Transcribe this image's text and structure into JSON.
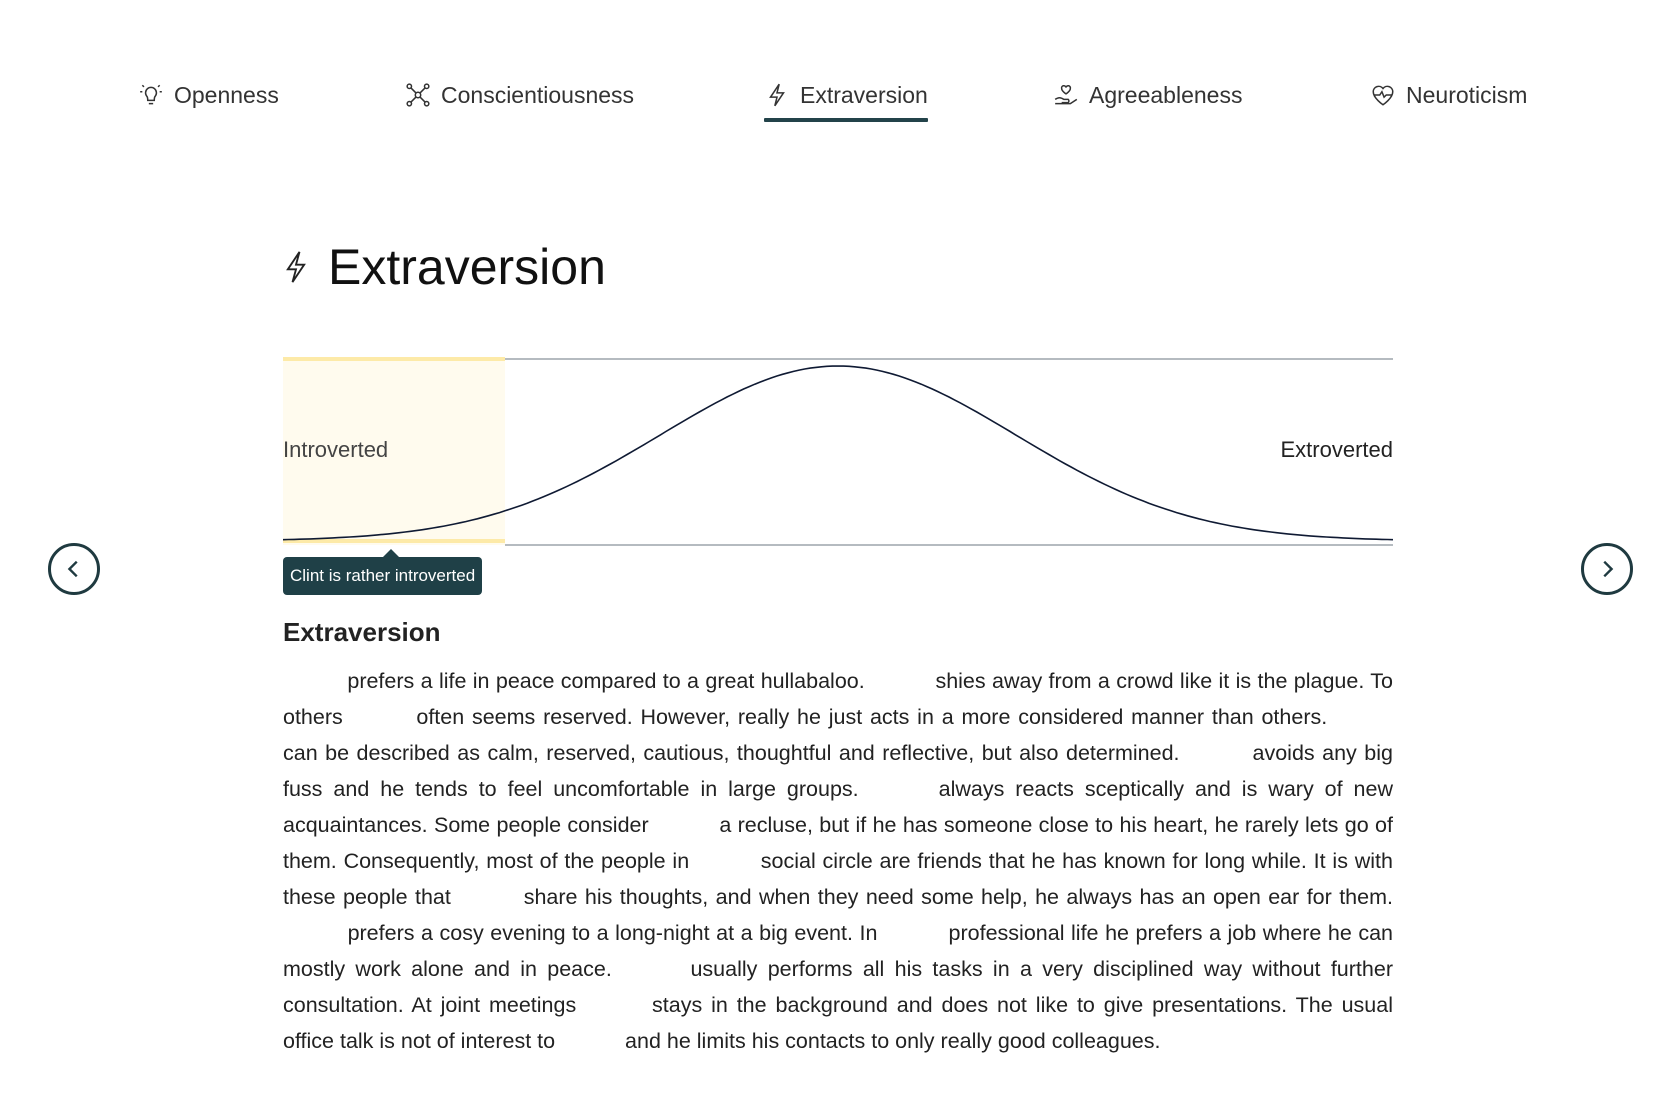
{
  "tabs": [
    {
      "label": "Openness",
      "icon": "lightbulb-icon",
      "active": false
    },
    {
      "label": "Conscientiousness",
      "icon": "network-icon",
      "active": false
    },
    {
      "label": "Extraversion",
      "icon": "lightning-icon",
      "active": true
    },
    {
      "label": "Agreeableness",
      "icon": "hand-heart-icon",
      "active": false
    },
    {
      "label": "Neuroticism",
      "icon": "heart-pulse-icon",
      "active": false
    }
  ],
  "colors": {
    "accent": "#23434a",
    "band": "#fffbee",
    "band_edge": "#fdeaa8",
    "curve": "#0f1a33"
  },
  "section": {
    "title": "Extraversion",
    "icon": "lightning-icon"
  },
  "chart_data": {
    "type": "area",
    "distribution": "normal",
    "mean_fraction": 0.5,
    "sd_fraction": 0.16,
    "left_label": "Introverted",
    "right_label": "Extroverted",
    "highlighted_range_fraction": [
      0,
      0.2
    ],
    "marker_label": "Clint is rather introverted"
  },
  "description": {
    "heading": "Extraversion",
    "segments": [
      "prefers a life in peace compared to a great hullabaloo.",
      "shies away from a crowd like it is the plague. To others",
      "often seems reserved. However, really he just acts in a more considered manner than others.",
      "can be described as calm, reserved, cautious, thoughtful and reflective, but also determined.",
      "avoids any big fuss and he tends to feel uncomfortable in large groups.",
      "always reacts sceptically and is wary of new acquaintances. Some people consider",
      "a recluse, but if he has someone close to his heart, he rarely lets go of them. Consequently, most of the people in",
      "social circle are friends that he has known for long while. It is with these people that",
      "share his thoughts, and when they need some help, he always has an open ear for them.",
      "prefers a cosy evening to a long-night at a big event. In",
      "professional life he prefers a job where he can mostly work alone and in peace.",
      "usually performs all his tasks in a very disciplined way without further consultation. At joint meetings",
      "stays in the background and does not like to give presentations. The usual office talk is not of interest to",
      "and he limits his contacts to only really good colleagues."
    ]
  },
  "nav": {
    "prev_icon": "chevron-left-icon",
    "next_icon": "chevron-right-icon"
  }
}
